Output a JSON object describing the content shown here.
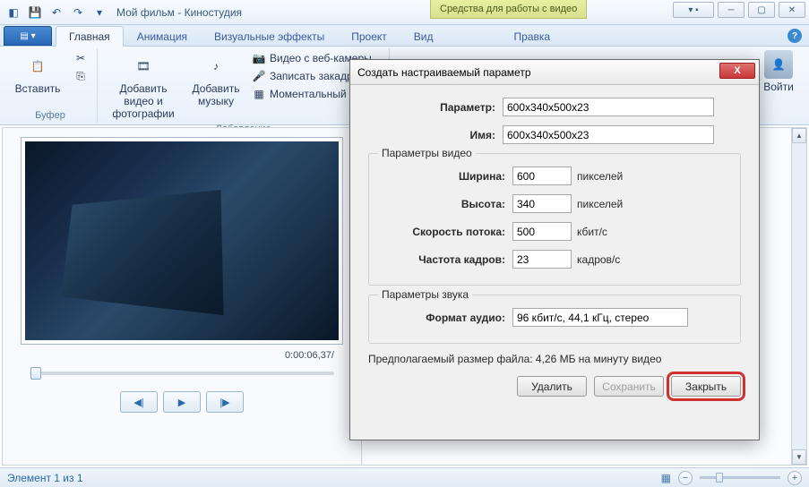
{
  "title": "Мой фильм - Киностудия",
  "context_tab": "Средства для работы с видео",
  "tabs": {
    "file": "",
    "main": "Главная",
    "anim": "Анимация",
    "fx": "Визуальные эффекты",
    "project": "Проект",
    "view": "Вид",
    "edit": "Правка"
  },
  "ribbon": {
    "paste": "Вставить",
    "add_media": "Добавить видео и фотографии",
    "add_music": "Добавить музыку",
    "webcam": "Видео с веб-камеры",
    "narrate": "Записать закадровый",
    "snapshot": "Моментальный снимо",
    "group_buffer": "Буфер",
    "group_add": "Добавление",
    "login": "Войти"
  },
  "preview": {
    "timecode": "0:00:06,37/"
  },
  "status": {
    "element": "Элемент 1 из 1"
  },
  "dialog": {
    "title": "Создать настраиваемый параметр",
    "param_label": "Параметр:",
    "param_value": "600x340x500x23",
    "name_label": "Имя:",
    "name_value": "600x340x500x23",
    "video_legend": "Параметры видео",
    "width_label": "Ширина:",
    "width_value": "600",
    "height_label": "Высота:",
    "height_value": "340",
    "bitrate_label": "Скорость потока:",
    "bitrate_value": "500",
    "fps_label": "Частота кадров:",
    "fps_value": "23",
    "px": "пикселей",
    "kbps": "кбит/с",
    "fps_unit": "кадров/с",
    "audio_legend": "Параметры звука",
    "audio_label": "Формат аудио:",
    "audio_value": "96 кбит/с, 44,1 кГц, стерео",
    "est": "Предполагаемый размер файла: 4,26 МБ на минуту видео",
    "delete": "Удалить",
    "save": "Сохранить",
    "close": "Закрыть"
  }
}
